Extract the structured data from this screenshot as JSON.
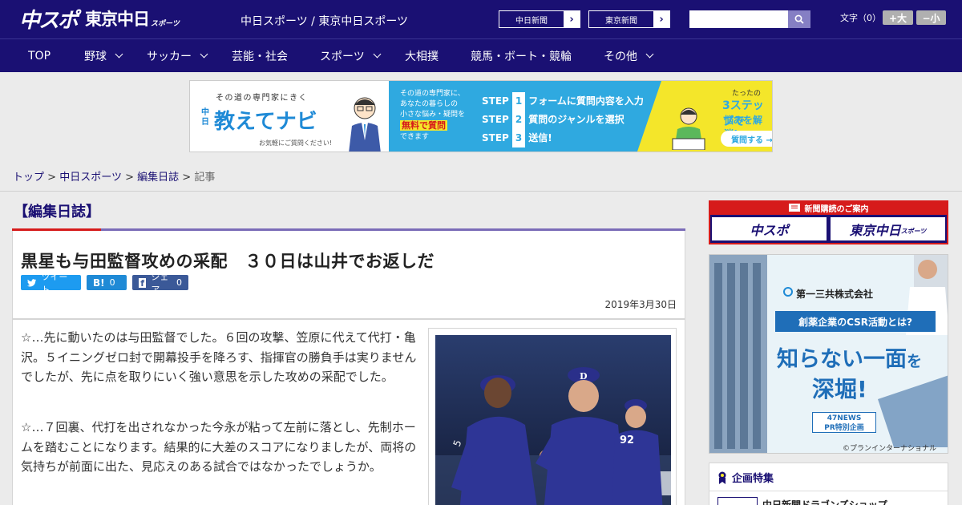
{
  "header": {
    "logo_primary": "中スポ",
    "logo_secondary": "東京中日",
    "logo_suffix": "スポーツ",
    "tagline": "中日スポーツ / 東京中日スポーツ",
    "chunichi_link": "中日新聞",
    "tokyo_link": "東京新聞",
    "link_arrow": "›",
    "search_placeholder": "",
    "fontsize_label": "文字（0）",
    "fontsize_up": "+大",
    "fontsize_down": "−小"
  },
  "nav": [
    {
      "label": "TOP",
      "dropdown": false
    },
    {
      "label": "野球",
      "dropdown": true
    },
    {
      "label": "サッカー",
      "dropdown": true
    },
    {
      "label": "芸能・社会",
      "dropdown": false
    },
    {
      "label": "スポーツ",
      "dropdown": true
    },
    {
      "label": "大相撲",
      "dropdown": false
    },
    {
      "label": "競馬・ボート・競輪",
      "dropdown": false
    },
    {
      "label": "その他",
      "dropdown": true
    }
  ],
  "banner": {
    "tag": "その道の専門家にきく",
    "brand_small": "中日",
    "brand": "教えてナビ",
    "note": "お気軽にご質問ください!",
    "desc1": "その道の専門家に、",
    "desc2": "あなたの暮らしの",
    "desc3": "小さな悩み・疑問を",
    "desc_em": "無料で質問",
    "desc4": "できます",
    "steps": [
      {
        "label": "STEP",
        "num": "1",
        "text": "フォームに質問内容を入力"
      },
      {
        "label": "STEP",
        "num": "2",
        "text": "質問のジャンルを選択"
      },
      {
        "label": "STEP",
        "num": "3",
        "text": "送信!"
      }
    ],
    "cta_small": "たったの",
    "cta_big": "3ステップで",
    "cta_line": "悩みを解消!",
    "cta_btn": "質問する →"
  },
  "breadcrumb": {
    "top": "トップ",
    "chuspo": "中日スポーツ",
    "diary": "編集日誌",
    "current": "記事",
    "sep": ">"
  },
  "section": {
    "title": "【編集日誌】"
  },
  "article": {
    "headline": "黒星も与田監督攻めの采配　３０日は山井でお返しだ",
    "share_tweet": "ツイート",
    "share_hatena": "B!",
    "share_hatena_count": "0",
    "share_fb": "シェア",
    "share_fb_count": "0",
    "date": "2019年3月30日",
    "paragraphs": [
      "☆…先に動いたのは与田監督でした。６回の攻撃、笠原に代えて代打・亀沢。５イニングゼロ封で開幕投手を降ろす、指揮官の勝負手は実りませんでしたが、先に点を取りにいく強い意思を示した攻めの采配でした。",
      "☆…７回裏、代打を出されなかった今永が粘って左前に落とし、先制ホームを踏むことになります。結果的に大差のスコアになりましたが、両将の気持ちが前面に出た、見応えのある試合ではなかったでしょうか。"
    ],
    "photo_jersey": "92",
    "photo_cap": "D"
  },
  "sidebar": {
    "subs_title": "新聞購読のご案内",
    "subs_a": "中スポ",
    "subs_b": "東京中日",
    "subs_b_suffix": "スポーツ",
    "ad_company": "第一三共株式会社",
    "ad_question": "創薬企業のCSR活動とは?",
    "ad_line1": "知らない一面",
    "ad_line1_suffix": "を",
    "ad_line2": "深堀!",
    "ad_source1": "47NEWS",
    "ad_source2": "PR特別企画",
    "ad_credit": "©プランインターナショナル",
    "feature_title": "企画特集",
    "feature_item": "中日新聞ドラゴンズショップ"
  },
  "colors": {
    "brand_navy": "#1a1073",
    "accent_red": "#d61b1b",
    "twitter": "#1d9bf0",
    "hatena": "#1f8ad6",
    "facebook": "#3b5998"
  }
}
